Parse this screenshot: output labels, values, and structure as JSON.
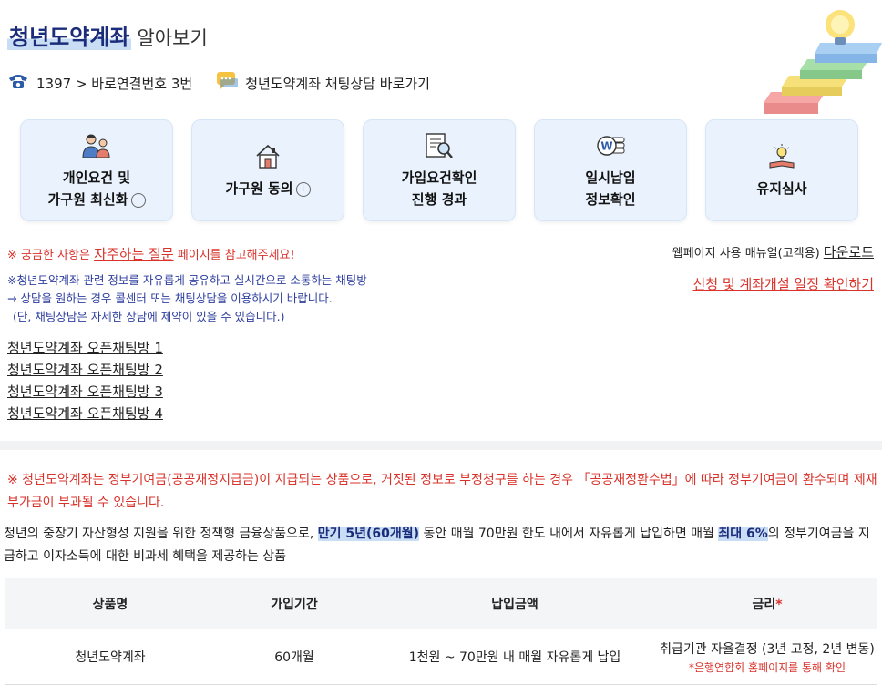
{
  "header": {
    "title_strong": "청년도약계좌",
    "title_rest": "알아보기"
  },
  "contacts": {
    "phone_text": "1397 > 바로연결번호 3번",
    "chat_text": "청년도약계좌 채팅상담 바로가기"
  },
  "cards": [
    {
      "line1": "개인요건 및",
      "line2": "가구원 최신화",
      "info": "i",
      "icon": "family-icon"
    },
    {
      "line1": "가구원 동의",
      "info": "i",
      "icon": "house-icon"
    },
    {
      "line1": "가입요건확인",
      "line2": "진행 경과",
      "icon": "document-search-icon"
    },
    {
      "line1": "일시납입",
      "line2": "정보확인",
      "icon": "won-coin-icon"
    },
    {
      "line1": "유지심사",
      "icon": "lightbulb-book-icon"
    }
  ],
  "notices": {
    "faq_prefix": "※ 궁금한 사항은 ",
    "faq_link": "자주하는 질문",
    "faq_suffix": " 페이지를 참고해주세요!",
    "manual_prefix": "웹페이지 사용 매뉴얼(고객용) ",
    "manual_link": "다운로드",
    "schedule_link": "신청 및 계좌개설 일정 확인하기",
    "chat_line1": "※청년도약계좌 관련 정보를 자유롭게 공유하고 실시간으로 소통하는 채팅방",
    "chat_line2": "→ 상담을 원하는 경우 콜센터 또는 채팅상담을 이용하시기 바랍니다.",
    "chat_line3": "(단, 채팅상담은 자세한 상담에 제약이 있을 수 있습니다.)"
  },
  "open_chats": [
    "청년도약계좌 오픈채팅방 1",
    "청년도약계좌 오픈채팅방 2",
    "청년도약계좌 오픈채팅방 3",
    "청년도약계좌 오픈채팅방 4"
  ],
  "warning": "※ 청년도약계좌는 정부기여금(공공재정지급금)이 지급되는 상품으로, 거짓된 정보로 부정청구를 하는 경우 「공공재정환수법」에 따라 정부기여금이 환수되며 제재부가금이 부과될 수 있습니다.",
  "description": {
    "part1": "청년의 중장기 자산형성 지원을 위한 정책형 금융상품으로, ",
    "hl1": "만기 5년(60개월)",
    "part2": " 동안 매월 70만원 한도 내에서 자유롭게 납입하면 매월 ",
    "hl2": "최대 6%",
    "part3": "의 정부기여금을 지급하고 이자소득에 대한 비과세 혜택을 제공하는 상품"
  },
  "table": {
    "headers": [
      "상품명",
      "가입기간",
      "납입금액",
      "금리"
    ],
    "required_mark": "*",
    "row": {
      "name": "청년도약계좌",
      "period": "60개월",
      "amount": "1천원 ~ 70만원 내 매월 자유롭게 납입",
      "rate": "취급기관 자율결정 (3년 고정, 2년 변동)",
      "rate_note": "*은행연합회 홈페이지를 통해 확인"
    }
  },
  "colors": {
    "accent_navy": "#1b2c7a",
    "card_bg": "#eaf3fd",
    "warning_red": "#d9332b",
    "notice_blue": "#2e3e9e"
  }
}
